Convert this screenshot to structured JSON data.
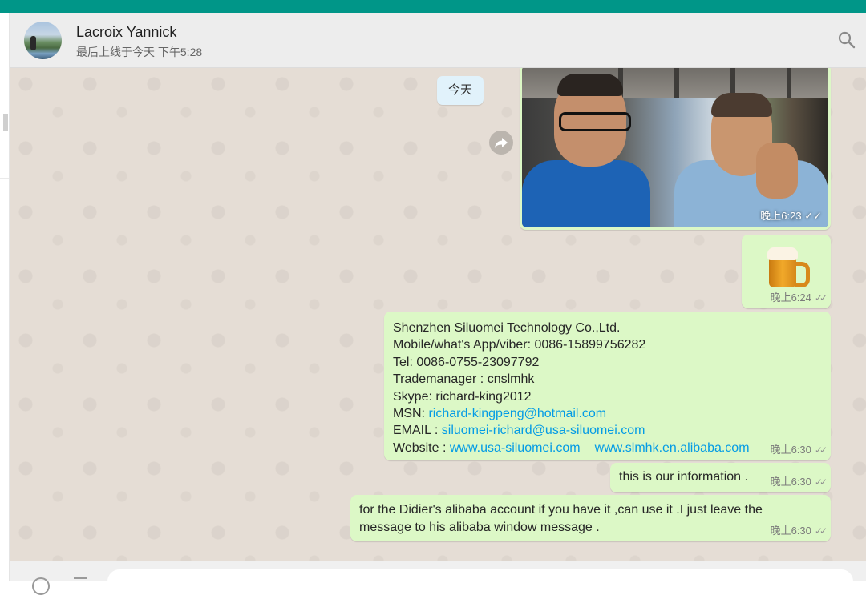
{
  "header": {
    "contact_name": "Lacroix Yannick",
    "last_seen": "最后上线于今天 下午5:28",
    "search_icon": "search-icon"
  },
  "chat": {
    "date_label": "今天",
    "photo_message": {
      "time": "晚上6:23",
      "status": "read"
    },
    "beer_message": {
      "emoji": "beer-mug-icon",
      "time": "晚上6:24",
      "status": "read"
    },
    "info_message": {
      "line1": "Shenzhen Siluomei Technology Co.,Ltd.",
      "line2": "Mobile/what's App/viber: 0086-15899756282",
      "line3": "Tel: 0086-0755-23097792",
      "line4": "Trademanager : cnslmhk",
      "line5": "Skype: richard-king2012",
      "msn_label": "MSN: ",
      "msn_link": "richard-kingpeng@hotmail.com",
      "email_label": "EMAIL : ",
      "email_link": "siluomei-richard@usa-siluomei.com",
      "website_label": "Website : ",
      "website_link1": "www.usa-siluomei.com",
      "website_link2": "www.slmhk.en.alibaba.com",
      "time": "晚上6:30",
      "status": "read"
    },
    "note_message": {
      "text": "this is our information .",
      "time": "晚上6:30",
      "status": "read"
    },
    "didier_message": {
      "text": "for the Didier's alibaba account if you have it ,can use it .I just leave the message to his alibaba window message .",
      "time": "晚上6:30",
      "status": "read"
    }
  },
  "colors": {
    "topbar": "#009688",
    "outgoing_bubble": "#dcf8c6",
    "chat_background": "#e5ddd5",
    "link": "#039be5"
  }
}
